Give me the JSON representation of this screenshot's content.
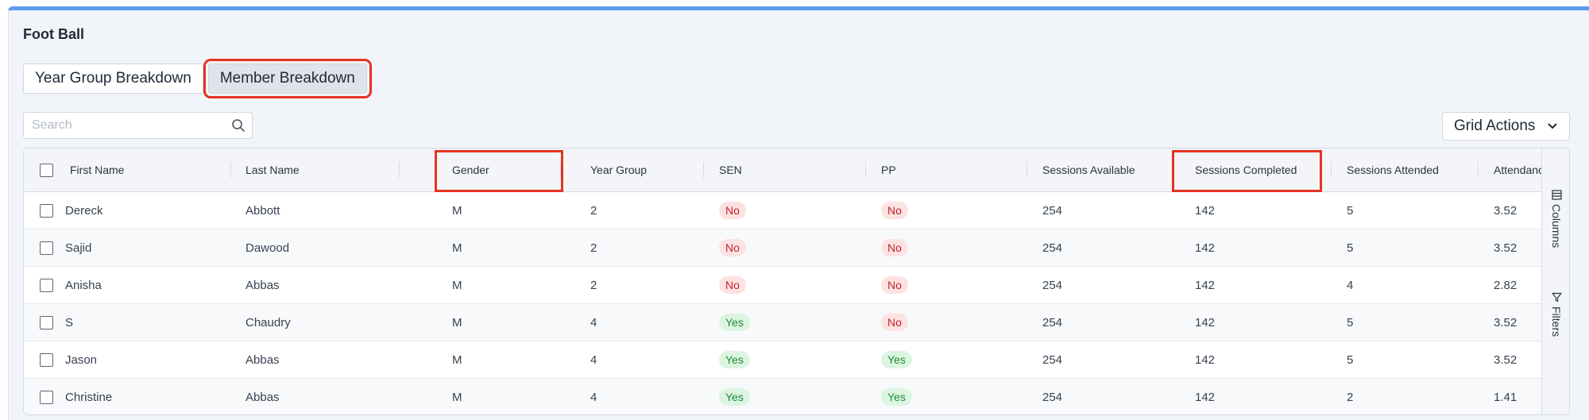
{
  "page": {
    "title": "Foot Ball"
  },
  "tabs": [
    {
      "label": "Year Group Breakdown",
      "active": false
    },
    {
      "label": "Member Breakdown",
      "active": true
    }
  ],
  "search": {
    "placeholder": "Search",
    "value": ""
  },
  "grid_actions": {
    "label": "Grid Actions"
  },
  "table": {
    "columns": [
      "First Name",
      "Last Name",
      "Gender",
      "Year Group",
      "SEN",
      "PP",
      "Sessions Available",
      "Sessions Completed",
      "Sessions Attended",
      "Attendance"
    ],
    "rows": [
      {
        "first_name": "Dereck",
        "last_name": "Abbott",
        "gender": "M",
        "year_group": "2",
        "sen": "No",
        "pp": "No",
        "sessions_available": "254",
        "sessions_completed": "142",
        "sessions_attended": "5",
        "attendance": "3.52"
      },
      {
        "first_name": "Sajid",
        "last_name": "Dawood",
        "gender": "M",
        "year_group": "2",
        "sen": "No",
        "pp": "No",
        "sessions_available": "254",
        "sessions_completed": "142",
        "sessions_attended": "5",
        "attendance": "3.52"
      },
      {
        "first_name": "Anisha",
        "last_name": "Abbas",
        "gender": "M",
        "year_group": "2",
        "sen": "No",
        "pp": "No",
        "sessions_available": "254",
        "sessions_completed": "142",
        "sessions_attended": "4",
        "attendance": "2.82"
      },
      {
        "first_name": "S",
        "last_name": "Chaudry",
        "gender": "M",
        "year_group": "4",
        "sen": "Yes",
        "pp": "No",
        "sessions_available": "254",
        "sessions_completed": "142",
        "sessions_attended": "5",
        "attendance": "3.52"
      },
      {
        "first_name": "Jason",
        "last_name": "Abbas",
        "gender": "M",
        "year_group": "4",
        "sen": "Yes",
        "pp": "Yes",
        "sessions_available": "254",
        "sessions_completed": "142",
        "sessions_attended": "5",
        "attendance": "3.52"
      },
      {
        "first_name": "Christine",
        "last_name": "Abbas",
        "gender": "M",
        "year_group": "4",
        "sen": "Yes",
        "pp": "Yes",
        "sessions_available": "254",
        "sessions_completed": "142",
        "sessions_attended": "2",
        "attendance": "1.41"
      }
    ]
  },
  "side_panel": {
    "columns_label": "Columns",
    "filters_label": "Filters"
  },
  "colors": {
    "accent": "#5b9bf0",
    "highlight": "#e63323",
    "badge_no_bg": "#fde2e2",
    "badge_no_text": "#c0262d",
    "badge_yes_bg": "#dcf5e1",
    "badge_yes_text": "#1d8c3a"
  }
}
